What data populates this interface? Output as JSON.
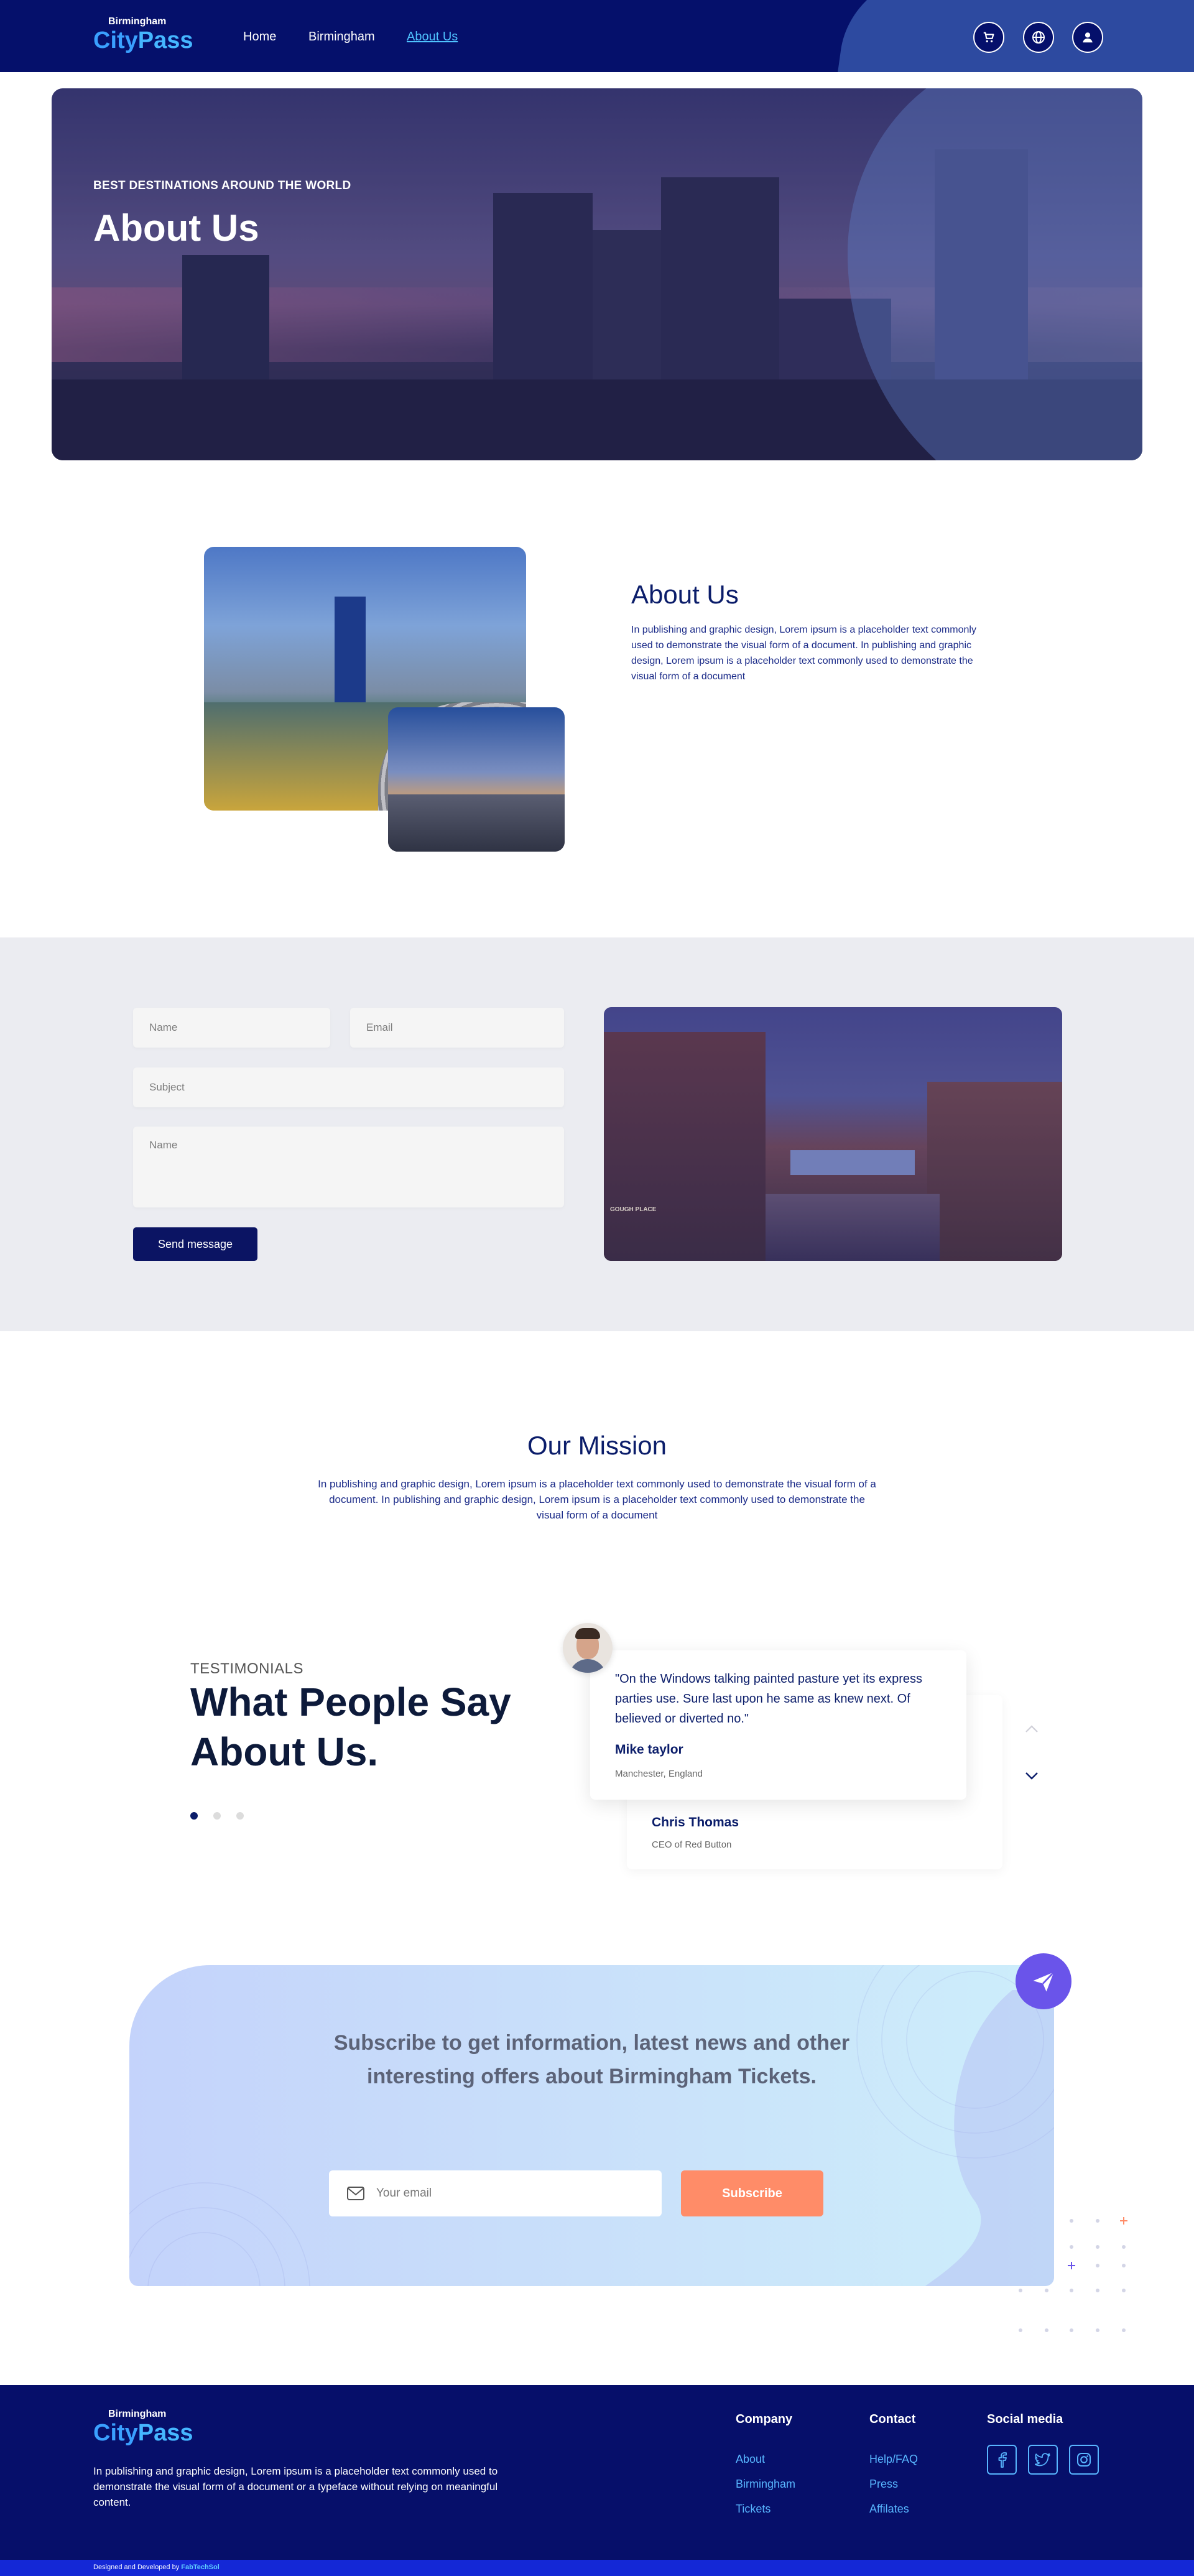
{
  "header": {
    "logo_small": "Birmingham",
    "logo_city": "City",
    "logo_pass": "Pass",
    "nav": [
      "Home",
      "Birmingham",
      "About Us"
    ],
    "icons": [
      "cart-icon",
      "globe-icon",
      "user-icon"
    ]
  },
  "hero": {
    "subtitle": "BEST DESTINATIONS AROUND THE WORLD",
    "title": "About Us"
  },
  "about": {
    "title": "About Us",
    "text": "In publishing and graphic design, Lorem ipsum is a placeholder text commonly used to demonstrate the visual form of a document. In publishing and graphic design, Lorem ipsum is a placeholder text commonly used to demonstrate the visual form of a document"
  },
  "contact": {
    "name_placeholder": "Name",
    "email_placeholder": "Email",
    "subject_placeholder": "Subject",
    "message_placeholder": "Name",
    "send_label": "Send message",
    "image_caption": "GOUGH PLACE"
  },
  "mission": {
    "title": "Our Mission",
    "text": "In publishing and graphic design, Lorem ipsum is a placeholder text commonly used to demonstrate the visual form of a document. In publishing and graphic design, Lorem ipsum is a placeholder text commonly used to demonstrate the visual form of a document"
  },
  "testimonials": {
    "tag": "TESTIMONIALS",
    "heading_line1": "What People Say",
    "heading_line2": "About Us.",
    "items": [
      {
        "quote": "\"On the Windows talking painted pasture yet its express parties use. Sure last upon he same as knew next. Of believed or diverted no.\"",
        "name": "Mike taylor",
        "location": "Manchester, England"
      },
      {
        "name": "Chris Thomas",
        "location": "CEO of Red Button"
      }
    ],
    "dots": 3,
    "active_dot": 0
  },
  "subscribe": {
    "heading_line1": "Subscribe to get information, latest news and other",
    "heading_line2": "interesting offers about Birmingham Tickets.",
    "email_placeholder": "Your email",
    "button_label": "Subscribe"
  },
  "footer": {
    "logo_small": "Birmingham",
    "logo_city": "City",
    "logo_pass": "Pass",
    "description": "In publishing and graphic design, Lorem ipsum is a placeholder text commonly used to demonstrate the visual form of a document or a typeface without relying on meaningful content.",
    "company_title": "Company",
    "company_links": [
      "About",
      "Birmingham",
      "Tickets"
    ],
    "contact_title": "Contact",
    "contact_links": [
      "Help/FAQ",
      "Press",
      "Affilates"
    ],
    "social_title": "Social media",
    "social_icons": [
      "facebook-icon",
      "twitter-icon",
      "instagram-icon"
    ],
    "credit_prefix": "Designed and Developed by ",
    "credit_brand": "FabTechSol"
  },
  "colors": {
    "navy": "#05106b",
    "accent_blue": "#45b6ff",
    "subscribe_orange": "#ff8c68",
    "plane_purple": "#6a54ea"
  }
}
